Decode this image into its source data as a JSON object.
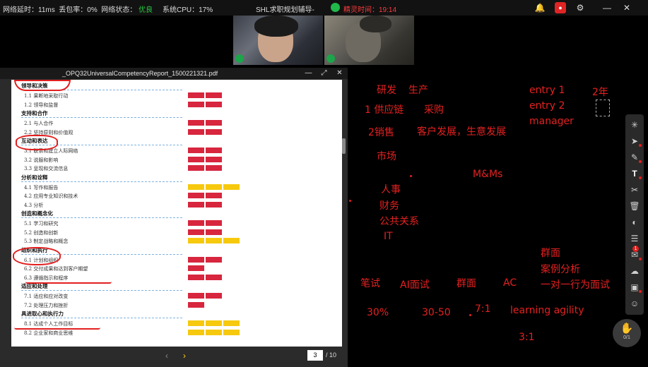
{
  "topbar": {
    "latency": "网络延时：11ms",
    "loss": "丢包率：0%",
    "net_status_label": "网络状态：",
    "net_status_value": "优良",
    "cpu": "系统CPU：17%",
    "title": "SHL求职规划辅导-",
    "timer": "精灵时间：19:14",
    "icons": [
      "bell-icon",
      "record-icon",
      "gear-icon",
      "minimize-icon",
      "close-icon"
    ]
  },
  "pdf": {
    "filename": "_OPQ32UniversalCompetencyReport_1500221321.pdf",
    "current_page": "3",
    "total_pages": "/ 10",
    "colors": {
      "red": "#d7263d",
      "yellow": "#f6c90e"
    },
    "sections": [
      {
        "title": "领导和决策",
        "items": [
          {
            "label": "1.1 果断地采取行动",
            "blocks": [
              "red",
              "red"
            ]
          },
          {
            "label": "1.2 领导和监督",
            "blocks": [
              "red",
              "red"
            ]
          }
        ]
      },
      {
        "title": "支持和合作",
        "items": [
          {
            "label": "2.1 与人合作",
            "blocks": [
              "red",
              "red"
            ]
          },
          {
            "label": "2.2 坚持原则和价值观",
            "blocks": [
              "red",
              "red"
            ]
          }
        ]
      },
      {
        "title": "互动和表达",
        "items": [
          {
            "label": "3.1 联系和建立人际网络",
            "blocks": [
              "red",
              "red"
            ]
          },
          {
            "label": "3.2 说服和影响",
            "blocks": [
              "red",
              "red"
            ]
          },
          {
            "label": "3.3 呈现和交流信息",
            "blocks": [
              "red",
              "red"
            ]
          }
        ]
      },
      {
        "title": "分析和诠释",
        "items": [
          {
            "label": "4.1 写作和报告",
            "blocks": [
              "yel",
              "yel",
              "yel"
            ]
          },
          {
            "label": "4.2 应用专业知识和技术",
            "blocks": [
              "red",
              "red"
            ]
          },
          {
            "label": "4.3 分析",
            "blocks": [
              "red",
              "red"
            ]
          }
        ]
      },
      {
        "title": "创造和概念化",
        "items": [
          {
            "label": "5.1 学习和研究",
            "blocks": [
              "red",
              "red"
            ]
          },
          {
            "label": "5.2 创造和创新",
            "blocks": [
              "red",
              "red"
            ]
          },
          {
            "label": "5.3 制定战略和概念",
            "blocks": [
              "yel",
              "yel",
              "yel"
            ]
          }
        ]
      },
      {
        "title": "组织和执行",
        "items": [
          {
            "label": "6.1 计划和组织",
            "blocks": [
              "red",
              "red"
            ]
          },
          {
            "label": "6.2 交付成果和达到客户期望",
            "blocks": [
              "red"
            ]
          },
          {
            "label": "6.3 遵循指示和程序",
            "blocks": [
              "red",
              "red"
            ]
          }
        ]
      },
      {
        "title": "适应和处理",
        "items": [
          {
            "label": "7.1 适应和应对改变",
            "blocks": [
              "red",
              "red"
            ]
          },
          {
            "label": "7.2 处理压力和挫折",
            "blocks": [
              "red"
            ]
          }
        ]
      },
      {
        "title": "具进取心和执行力",
        "items": [
          {
            "label": "8.1 达成个人工作目标",
            "blocks": [
              "yel",
              "yel",
              "yel"
            ]
          },
          {
            "label": "8.2 企业家和商业思维",
            "blocks": [
              "yel",
              "yel",
              "yel"
            ]
          }
        ]
      }
    ]
  },
  "annotations": {
    "rd": "研发",
    "production": "生产",
    "supply": "1 供应链",
    "purchase": "采购",
    "sales": "2销售",
    "bizdev": "客户发展，生意发展",
    "market": "市场",
    "mms": "M&Ms",
    "hr": "人事",
    "finance": "财务",
    "pr": "公共关系",
    "it": "IT",
    "entry1": "entry 1",
    "entry2": "entry 2",
    "manager": "manager",
    "years": "2年",
    "group_face": "群面",
    "case": "案例分析",
    "written": "笔试",
    "ai": "AI面试",
    "group_face2": "群面",
    "ac": "AC",
    "one_on_one": "一对一行为面试",
    "p30": "30%",
    "r3050": "30-50",
    "r71": "7:1",
    "agility": "learning agility",
    "r31": "3:1"
  },
  "toolbar": {
    "tools": [
      {
        "name": "laser-pointer-icon",
        "glyph": "✳",
        "dot": false
      },
      {
        "name": "select-arrow-icon",
        "glyph": "➤",
        "dot": true
      },
      {
        "name": "pen-icon",
        "glyph": "✎",
        "dot": true
      },
      {
        "name": "text-tool-icon",
        "glyph": "T",
        "dot": true,
        "active": true
      },
      {
        "name": "scissors-icon",
        "glyph": "✂",
        "dot": false
      },
      {
        "name": "trash-icon",
        "glyph": "🗑",
        "dot": false
      },
      {
        "name": "record-toggle-icon",
        "glyph": "◐",
        "dot": false
      },
      {
        "name": "whiteboard-icon",
        "glyph": "☰",
        "dot": false
      },
      {
        "name": "chat-icon",
        "glyph": "✉",
        "dot": true,
        "badge": "1"
      },
      {
        "name": "cloud-icon",
        "glyph": "☁",
        "dot": false
      },
      {
        "name": "toolbox-icon",
        "glyph": "▣",
        "dot": true
      },
      {
        "name": "members-icon",
        "glyph": "☺",
        "dot": false
      }
    ],
    "hand_count": "0/1"
  }
}
